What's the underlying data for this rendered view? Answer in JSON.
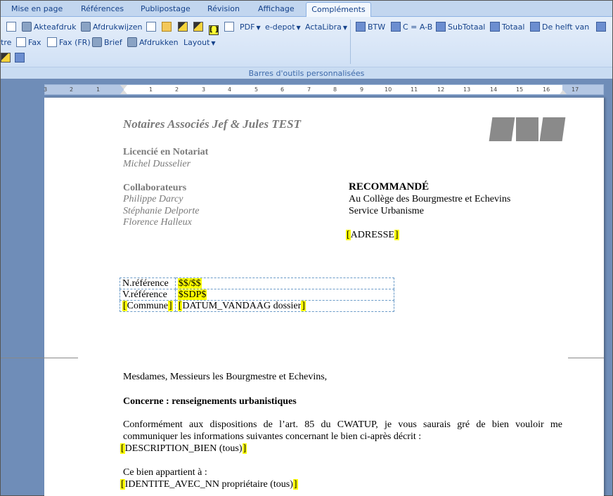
{
  "tabs": [
    "Mise en page",
    "Références",
    "Publipostage",
    "Révision",
    "Affichage",
    "Compléments"
  ],
  "active_tab": "Compléments",
  "ribbon": {
    "row1_left": [
      {
        "icon": "document-icon",
        "label": ""
      },
      {
        "icon": "printer-icon",
        "label": "Akteafdruk"
      },
      {
        "icon": "print-edit-icon",
        "label": "Afdrukwijzen"
      },
      {
        "icon": "copy-document-icon",
        "label": ""
      },
      {
        "icon": "open-folder-icon",
        "label": ""
      },
      {
        "icon": "fill-icon",
        "label": ""
      },
      {
        "icon": "pen-icon",
        "label": ""
      },
      {
        "icon": "brackets-icon",
        "label": "[ ]"
      },
      {
        "icon": "refresh-icon",
        "label": ""
      }
    ],
    "pdf_label": "PDF",
    "edepot_label": "e-depot",
    "actalibra_label": "ActaLibra",
    "row1_right": [
      {
        "icon": "calculator-icon",
        "label": "BTW"
      },
      {
        "icon": "calculator-icon",
        "label": "C = A-B"
      },
      {
        "icon": "calculator-icon",
        "label": "SubTotaal"
      },
      {
        "icon": "calculator-icon",
        "label": "Totaal"
      },
      {
        "icon": "calculator-icon",
        "label": "De helft van"
      }
    ],
    "row2": [
      {
        "icon": "",
        "label": "tre"
      },
      {
        "icon": "fax-icon",
        "label": "Fax"
      },
      {
        "icon": "fax-icon",
        "label": "Fax (FR)"
      },
      {
        "icon": "letter-icon",
        "label": "Brief"
      },
      {
        "icon": "printer-icon",
        "label": "Afdrukken"
      }
    ],
    "layout_label": "Layout",
    "group_label": "Barres d'outils personnalisées"
  },
  "ruler": {
    "ticks": [
      "3",
      "2",
      "1",
      "1",
      "2",
      "3",
      "4",
      "5",
      "6",
      "7",
      "8",
      "9",
      "10",
      "11",
      "12",
      "13",
      "14",
      "15",
      "16",
      "17"
    ]
  },
  "document": {
    "firm_name": "Notaires Associés Jef & Jules TEST",
    "licence_title": "Licencié en Notariat",
    "licence_name": "Michel Dusselier",
    "collab_title": "Collaborateurs",
    "collaborators": [
      "Philippe Darcy",
      "Stéphanie Delporte",
      "Florence Halleux"
    ],
    "recipient_head": "RECOMMANDÉ",
    "recipient_lines": [
      "Au Collège des Bourgmestre et Echevins",
      "Service Urbanisme"
    ],
    "address_field": "ADRESSE",
    "ref_table": [
      {
        "label": "N.référence",
        "value": "$$/$$"
      },
      {
        "label": "V.référence",
        "value": "$SDP$"
      },
      {
        "label": "Commune",
        "value": "DATUM_VANDAAG dossier"
      }
    ],
    "salutation": "Mesdames, Messieurs les Bourgmestre et Echevins,",
    "subject": "Concerne : renseignements urbanistiques",
    "body_line1": "Conformément aux dispositions de l’art. 85 du CWATUP, je vous saurais gré de bien vouloir me",
    "body_line2": "communiquer les informations suivantes concernant le bien ci-après décrit :",
    "description_field": "DESCRIPTION_BIEN (tous)",
    "owner_intro": "Ce bien appartient à :",
    "owner_field": "IDENTITE_AVEC_NN propriétaire (tous)"
  }
}
